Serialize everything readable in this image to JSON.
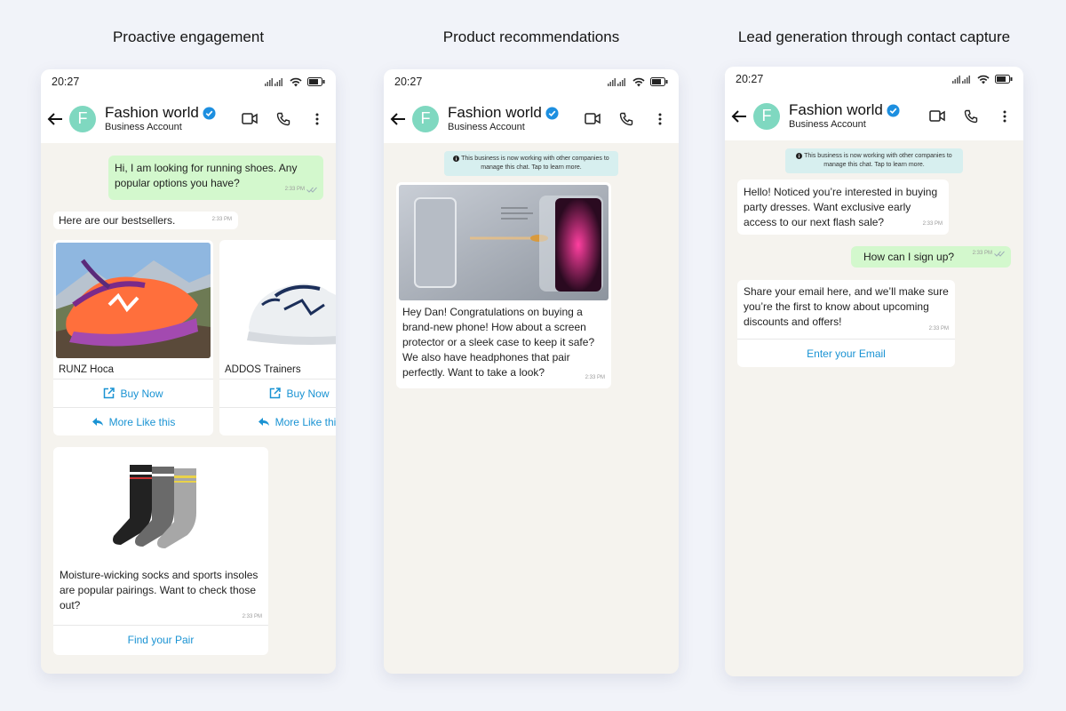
{
  "titles": {
    "panel1": "Proactive engagement",
    "panel2": "Product recommendations",
    "panel3": "Lead generation through contact capture"
  },
  "status": {
    "time": "20:27"
  },
  "chat": {
    "name": "Fashion world",
    "subtitle": "Business Account",
    "avatar_letter": "F"
  },
  "panel1": {
    "user_msg": "Hi, I am looking for running shoes. Any popular options you have?",
    "user_time": "2:33 PM",
    "bestsellers_msg": "Here are our bestsellers.",
    "bestsellers_time": "2:33 PM",
    "products": [
      {
        "name": "RUNZ Hoca",
        "buy": "Buy Now",
        "more": "More Like this"
      },
      {
        "name": "ADDOS Trainers",
        "buy": "Buy Now",
        "more": "More Like this"
      }
    ],
    "socks_msg": "Moisture-wicking socks and sports insoles are popular pairings. Want to check those out?",
    "socks_time": "2:33 PM",
    "socks_action": "Find your Pair"
  },
  "panel2": {
    "notice": "This business is now working with other companies to manage this chat. Tap to learn more.",
    "message": "Hey Dan! Congratulations on buying a brand-new phone! How about a screen protector or a sleek case to keep it safe? We also have headphones that pair perfectly. Want to take a look?",
    "time": "2:33 PM"
  },
  "panel3": {
    "notice": "This business is now working with other companies to manage this chat. Tap to learn more.",
    "greeting": "Hello! Noticed you’re interested in buying party dresses. Want exclusive early access to our next flash sale?",
    "greeting_time": "2:33 PM",
    "user_msg": "How can I sign up?",
    "user_time": "2:33 PM",
    "email_msg": "Share your email here, and we’ll make sure you’re the first to know about upcoming discounts and offers!",
    "email_time": "2:33 PM",
    "email_action": "Enter your Email"
  },
  "colors": {
    "accent": "#1a93d3",
    "outgoing_bubble": "#d3f8cd",
    "chat_bg": "#f5f3ee",
    "avatar": "#7fd8c0",
    "verified": "#1d8fe0"
  },
  "icons": [
    "back-arrow-icon",
    "verified-badge-icon",
    "video-call-icon",
    "phone-call-icon",
    "more-options-icon",
    "signal-icon",
    "wifi-icon",
    "battery-icon",
    "external-link-icon",
    "reply-icon",
    "double-check-icon",
    "info-icon"
  ]
}
